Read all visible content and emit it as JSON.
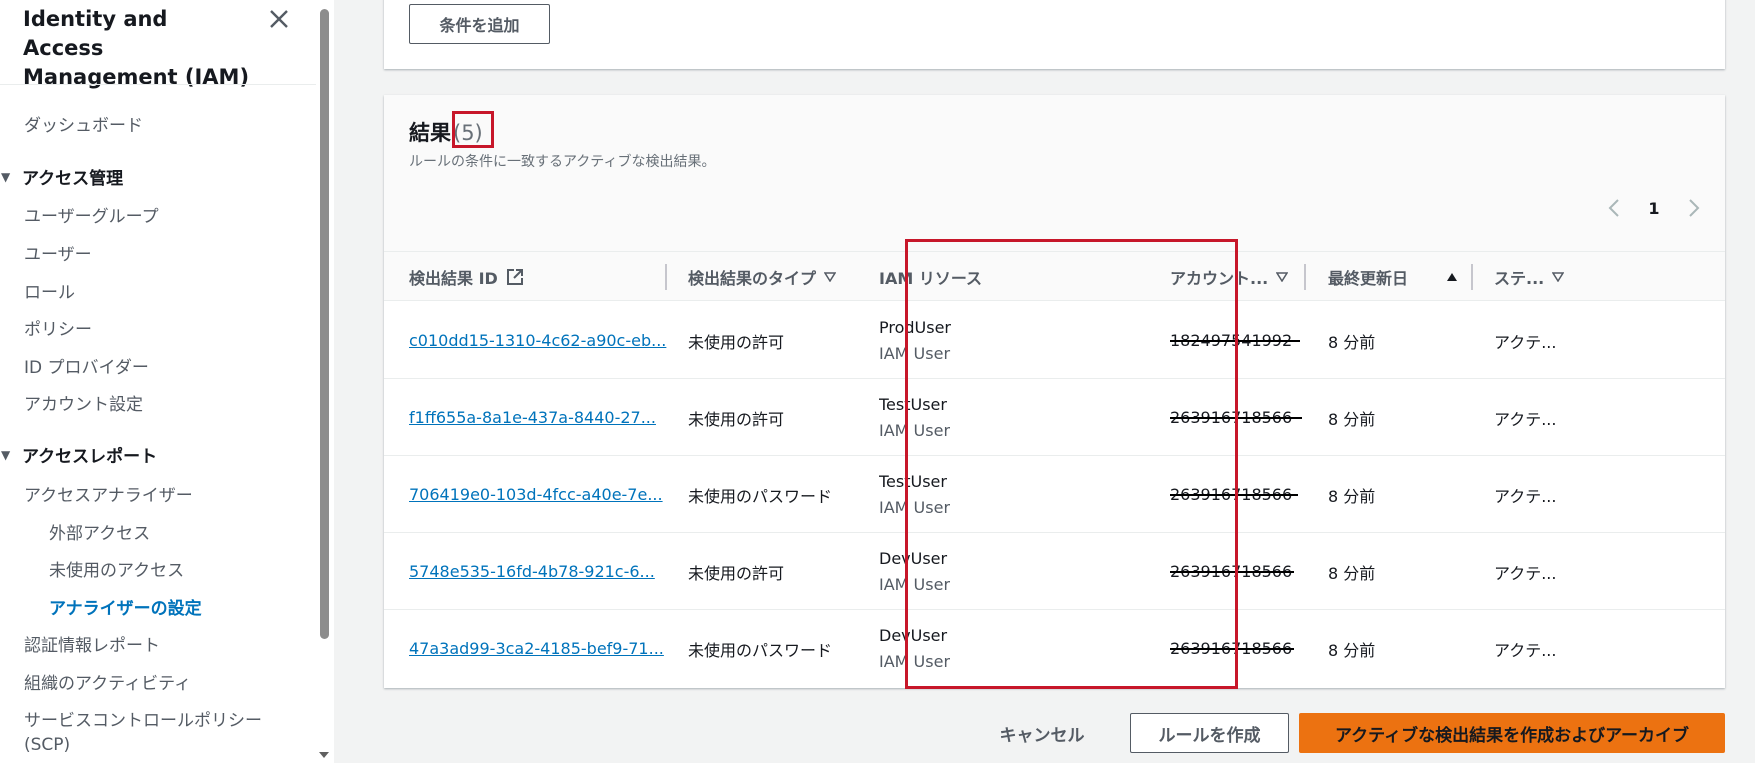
{
  "sidebar": {
    "title": "Identity and Access Management (IAM)",
    "dashboard": "ダッシュボード",
    "access_management": {
      "label": "アクセス管理",
      "items": [
        "ユーザーグループ",
        "ユーザー",
        "ロール",
        "ポリシー",
        "ID プロバイダー",
        "アカウント設定"
      ]
    },
    "access_reports": {
      "label": "アクセスレポート",
      "analyzer": "アクセスアナライザー",
      "analyzer_items": [
        "外部アクセス",
        "未使用のアクセス",
        "アナライザーの設定"
      ],
      "items": [
        "認証情報レポート",
        "組織のアクティビティ",
        "サービスコントロールポリシー",
        "(SCP)"
      ]
    },
    "active_item": "アナライザーの設定"
  },
  "top_panel": {
    "add_condition_label": "条件を追加"
  },
  "results": {
    "title": "結果",
    "count": "(5)",
    "description": "ルールの条件に一致するアクティブな検出結果。",
    "page": "1",
    "columns": {
      "finding_id": "検出結果 ID",
      "finding_type": "検出結果のタイプ",
      "iam_resource": "IAM リソース",
      "account": "アカウント...",
      "last_updated": "最終更新日",
      "status": "ステ..."
    },
    "rows": [
      {
        "id": "c010dd15-1310-4c62-a90c-eb...",
        "type": "未使用の許可",
        "resource": "ProdUser",
        "resource_type": "IAM User",
        "account": "182497541992",
        "updated": "8 分前",
        "status": "アクテ..."
      },
      {
        "id": "f1ff655a-8a1e-437a-8440-27...",
        "type": "未使用の許可",
        "resource": "TestUser",
        "resource_type": "IAM User",
        "account": "263916718566",
        "updated": "8 分前",
        "status": "アクテ..."
      },
      {
        "id": "706419e0-103d-4fcc-a40e-7e...",
        "type": "未使用のパスワード",
        "resource": "TestUser",
        "resource_type": "IAM User",
        "account": "263916718566",
        "updated": "8 分前",
        "status": "アクテ..."
      },
      {
        "id": "5748e535-16fd-4b78-921c-6...",
        "type": "未使用の許可",
        "resource": "DevUser",
        "resource_type": "IAM User",
        "account": "263916718566",
        "updated": "8 分前",
        "status": "アクテ..."
      },
      {
        "id": "47a3ad99-3ca2-4185-bef9-71...",
        "type": "未使用のパスワード",
        "resource": "DevUser",
        "resource_type": "IAM User",
        "account": "263916718566",
        "updated": "8 分前",
        "status": "アクテ..."
      }
    ]
  },
  "footer": {
    "cancel": "キャンセル",
    "create_rule": "ルールを作成",
    "create_and_archive": "アクティブな検出結果を作成およびアーカイブ"
  },
  "colors": {
    "link": "#0073bb",
    "primary": "#ec7211",
    "highlight": "#c7172a"
  },
  "icons": [
    "close-icon",
    "external-link-icon",
    "sort-down-icon",
    "sort-up-icon",
    "chevron-left-icon",
    "chevron-right-icon",
    "caret-down-icon"
  ]
}
